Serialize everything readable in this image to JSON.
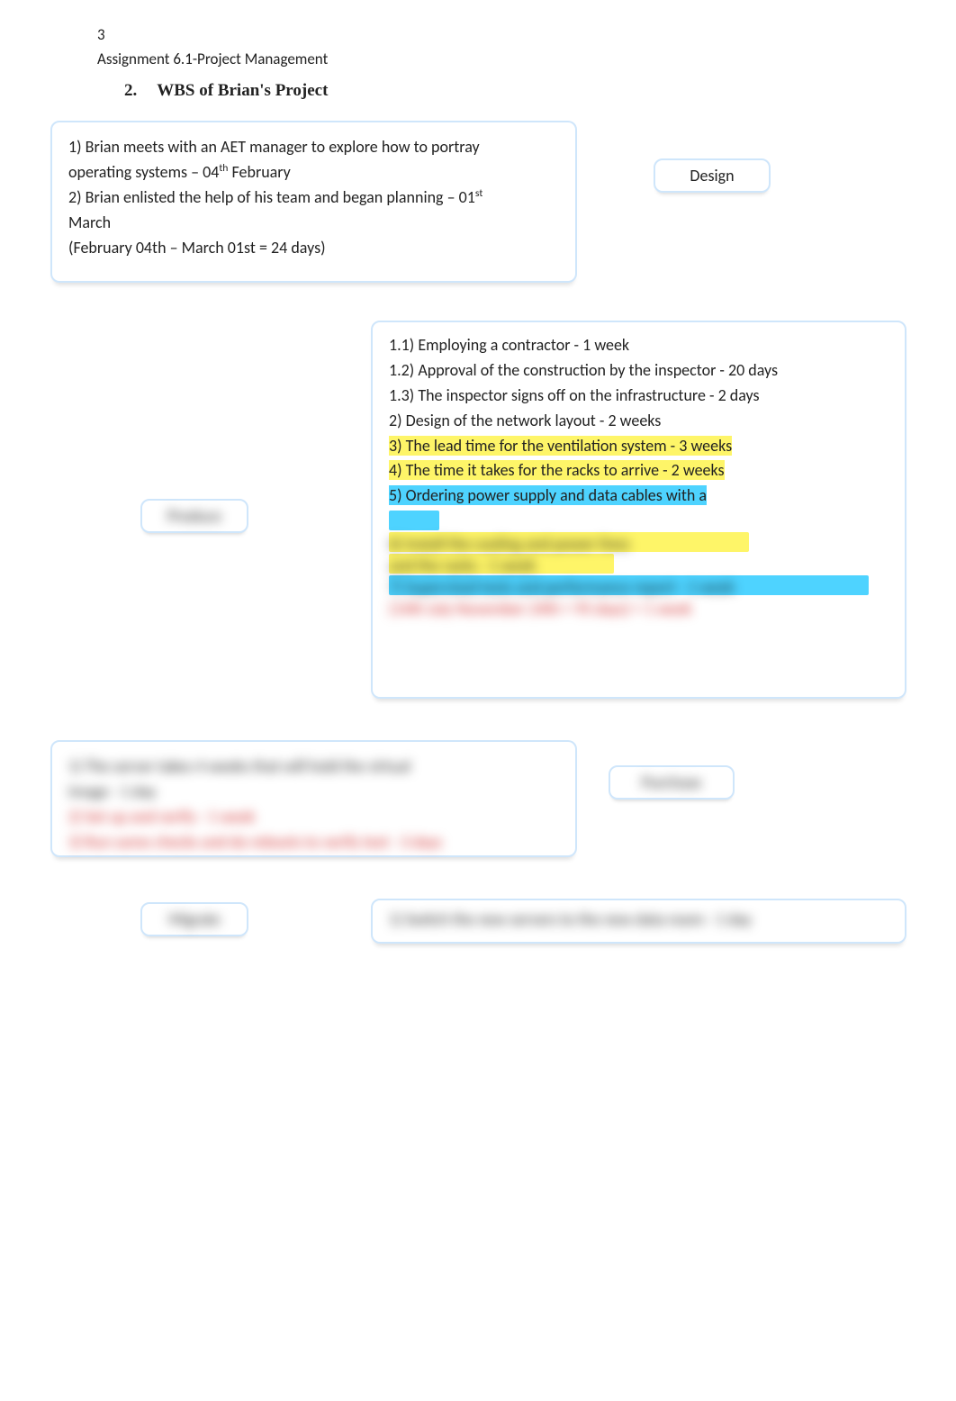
{
  "page": {
    "number": "3",
    "header": "Assignment 6.1-Project Management"
  },
  "section": {
    "number": "2.",
    "title": "WBS of Brian's Project"
  },
  "tags": {
    "design": "Design",
    "produce": "Produce",
    "purchase": "Purchase",
    "migrate": "Migrate"
  },
  "block1": {
    "l1a": "1) Brian meets with an AET manager to explore how to portray",
    "l1b_pre": "operating systems – 04",
    "l1b_sup": "th",
    "l1b_post": " February",
    "l2a_pre": "2) Brian enlisted the help of his team and began planning – 01",
    "l2a_sup": "st",
    "l2b": "March",
    "l3": "(February 04th – March 01st = 24 days)"
  },
  "block2": {
    "l1": "1.1) Employing a contractor - 1 week",
    "l2": "1.2) Approval of the construction by the inspector - 20 days",
    "l3": "1.3) The inspector signs off on the infrastructure - 2 days",
    "l4": "2) Design of the network layout - 2 weeks",
    "l5": "3) The lead time for the ventilation system - 3 weeks",
    "l6": "4) The time it takes for the racks to arrive - 2 weeks",
    "l7": "5) Ordering power supply and data cables with a",
    "blur1": "6) Install the cooling and power lines",
    "blur2": "and the racks - 1 week",
    "blur3": "7) Supervised tests and performance report - 1 week",
    "blur4": "(14th July November 24th = 95 days)    = 1 week"
  },
  "block3": {
    "l1": "1) The server takes 4 weeks that will hold the virtual",
    "l2": "image - 1 day",
    "l3": "2) Set up and verify - 1 week",
    "l4": "3) Run some checks and do reboots to verify test - 3 days"
  },
  "block4": {
    "l1": "1) Switch the new servers to the new data room - 1 day"
  }
}
